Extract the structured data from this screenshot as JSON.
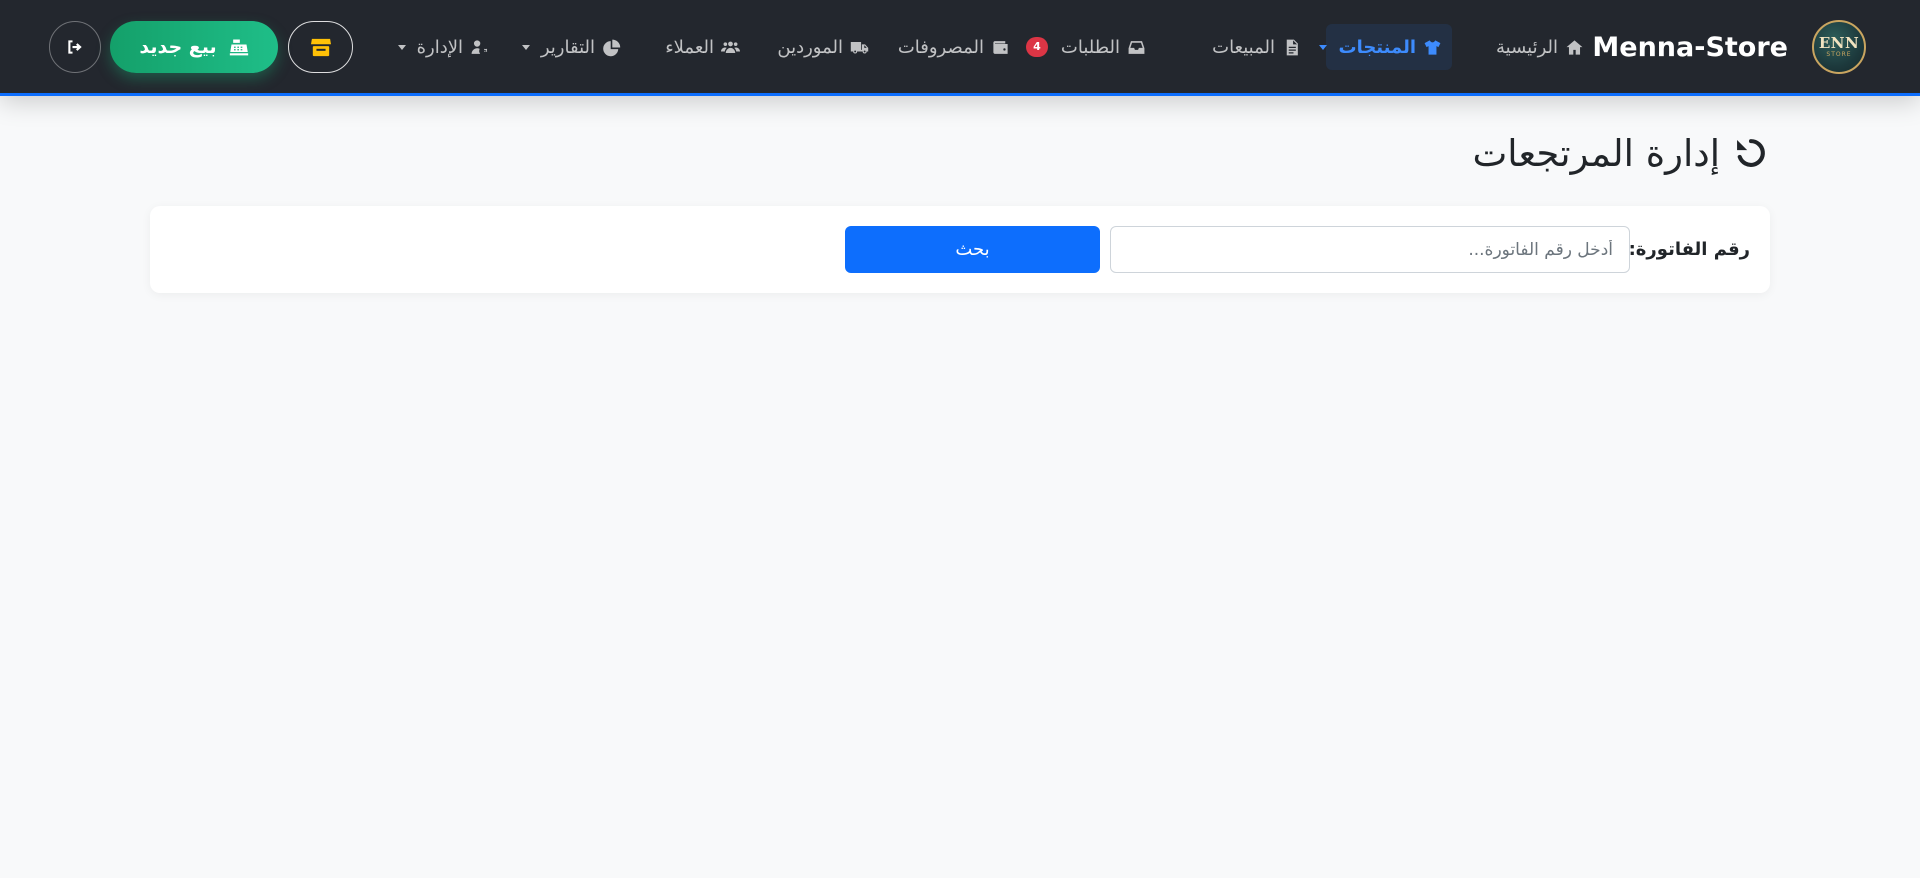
{
  "brand": {
    "name": "Menna-Store",
    "logo_text": "ENN",
    "logo_subtext": "STORE"
  },
  "nav": {
    "home": "الرئيسية",
    "products": "المنتجات",
    "sales": "المبيعات",
    "orders": "الطلبات",
    "orders_badge": "4",
    "expenses": "المصروفات",
    "suppliers": "الموردين",
    "customers": "العملاء",
    "reports": "التقارير",
    "admin": "الإدارة"
  },
  "actions": {
    "new_sale": "بيع جديد"
  },
  "page": {
    "title": "إدارة المرتجعات"
  },
  "search": {
    "label": "رقم الفاتورة:",
    "placeholder": "أدخل رقم الفاتورة...",
    "value": "",
    "button": "بحث"
  },
  "colors": {
    "navbar_bg": "#23272e",
    "accent_blue": "#0d6efd",
    "active_nav_text": "#3d8bfd",
    "success_green": "#1fbe88",
    "badge_red": "#dc3545",
    "store_icon_yellow": "#ffc107",
    "page_bg": "#f8f9fa"
  },
  "icons": {
    "home": "home-icon",
    "products": "shirt-icon",
    "sales": "file-invoice-icon",
    "orders": "inbox-icon",
    "expenses": "wallet-icon",
    "suppliers": "truck-icon",
    "customers": "users-icon",
    "reports": "pie-chart-icon",
    "admin": "user-gear-icon",
    "store": "store-icon",
    "new_sale": "cash-register-icon",
    "logout": "logout-icon",
    "title": "undo-icon"
  }
}
